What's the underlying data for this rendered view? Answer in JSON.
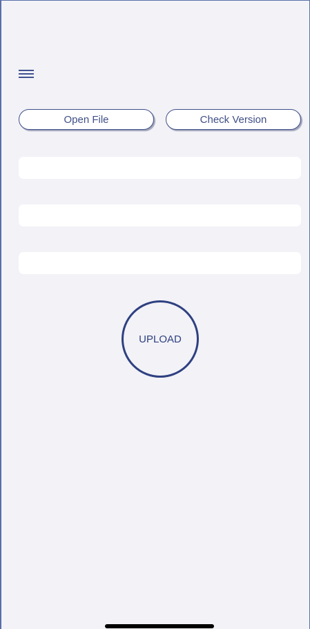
{
  "toolbar": {
    "menu_icon": "hamburger-menu-icon"
  },
  "actions": {
    "open_file_label": "Open File",
    "check_version_label": "Check Version"
  },
  "fields": [
    {
      "value": "",
      "placeholder": ""
    },
    {
      "value": "",
      "placeholder": ""
    },
    {
      "value": "",
      "placeholder": ""
    }
  ],
  "upload": {
    "label": "UPLOAD"
  },
  "colors": {
    "accent": "#2f4080",
    "background": "#f2f2f7",
    "field_background": "#ffffff"
  }
}
